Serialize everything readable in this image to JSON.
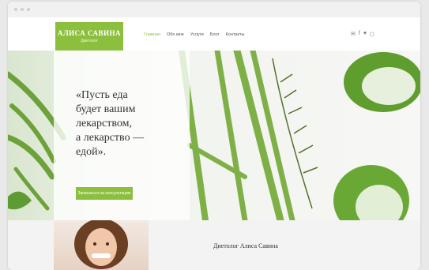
{
  "brand": {
    "name": "АЛИСА САВИНА",
    "tagline": "Диетолог"
  },
  "nav": {
    "items": [
      {
        "label": "Главная",
        "active": true
      },
      {
        "label": "Обо мне",
        "active": false
      },
      {
        "label": "Услуги",
        "active": false
      },
      {
        "label": "Блог",
        "active": false
      },
      {
        "label": "Контакты",
        "active": false
      }
    ],
    "social_icons": [
      "vk-icon",
      "facebook-icon",
      "twitter-icon",
      "instagram-icon"
    ]
  },
  "hero": {
    "quote_lines": [
      "«Пусть еда",
      "будет вашим",
      "лекарством,",
      "а лекарство —",
      "едой»."
    ],
    "cta_label": "Записаться на консультацию"
  },
  "about": {
    "title": "Диетолог Алиса Савина"
  },
  "colors": {
    "accent": "#8dbf3e",
    "text": "#333333"
  }
}
